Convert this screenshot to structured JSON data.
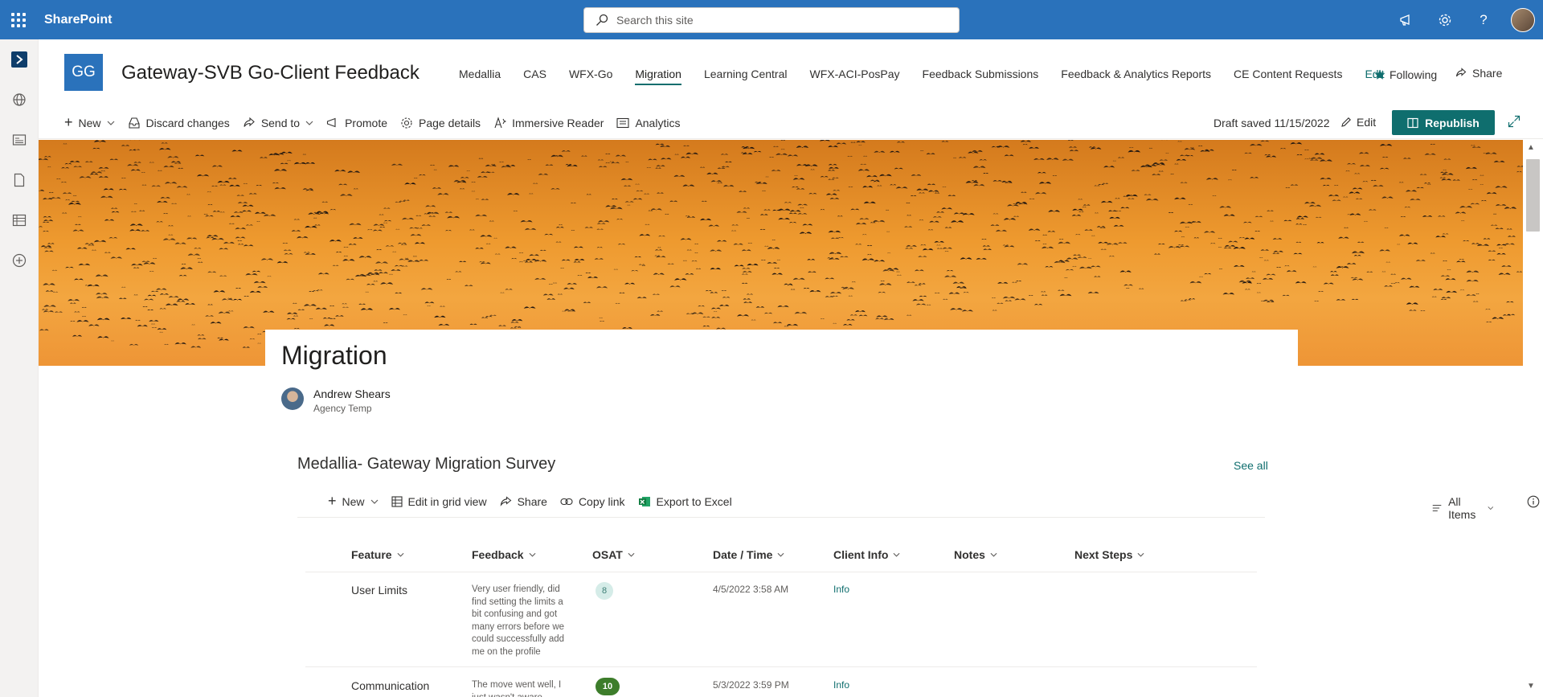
{
  "suite": {
    "brand": "SharePoint",
    "search_placeholder": "Search this site"
  },
  "site": {
    "logo": "GG",
    "title": "Gateway-SVB Go-Client Feedback",
    "nav": [
      "Medallia",
      "CAS",
      "WFX-Go",
      "Migration",
      "Learning Central",
      "WFX-ACI-PosPay",
      "Feedback Submissions",
      "Feedback & Analytics Reports",
      "CE Content Requests"
    ],
    "nav_active": "Migration",
    "nav_edit": "Edit",
    "following": "Following",
    "share": "Share"
  },
  "commands": {
    "new": "New",
    "discard": "Discard changes",
    "send_to": "Send to",
    "promote": "Promote",
    "page_details": "Page details",
    "immersive": "Immersive Reader",
    "analytics": "Analytics",
    "draft_status": "Draft saved 11/15/2022",
    "edit": "Edit",
    "republish": "Republish"
  },
  "page": {
    "title": "Migration",
    "author_name": "Andrew Shears",
    "author_role": "Agency Temp"
  },
  "list": {
    "title": "Medallia- Gateway Migration Survey",
    "see_all": "See all",
    "commands": {
      "new": "New",
      "grid": "Edit in grid view",
      "share": "Share",
      "copy": "Copy link",
      "export": "Export to Excel",
      "view": "All Items"
    },
    "columns": [
      "Feature",
      "Feedback",
      "OSAT",
      "Date / Time",
      "Client Info",
      "Notes",
      "Next Steps"
    ],
    "rows": [
      {
        "feature": "User Limits",
        "feedback": "Very user friendly, did find setting the limits a bit confusing and got many errors before we could successfully add me on the profile",
        "osat": "8",
        "date": "4/5/2022 3:58 AM",
        "client_info": "Info"
      },
      {
        "feature": "Communication",
        "feedback": "The move went well, I just wasn't aware maybe",
        "osat": "10",
        "date": "5/3/2022 3:59 PM",
        "client_info": "Info"
      }
    ]
  },
  "icons": {
    "waffle": "app-launcher-icon",
    "search": "search-icon",
    "megaphone": "megaphone-icon",
    "settings": "gear-icon",
    "help": "help-icon"
  },
  "colors": {
    "suite_bar": "#2a72bb",
    "accent": "#0f6e6e",
    "hero": "#ee9a2f"
  }
}
